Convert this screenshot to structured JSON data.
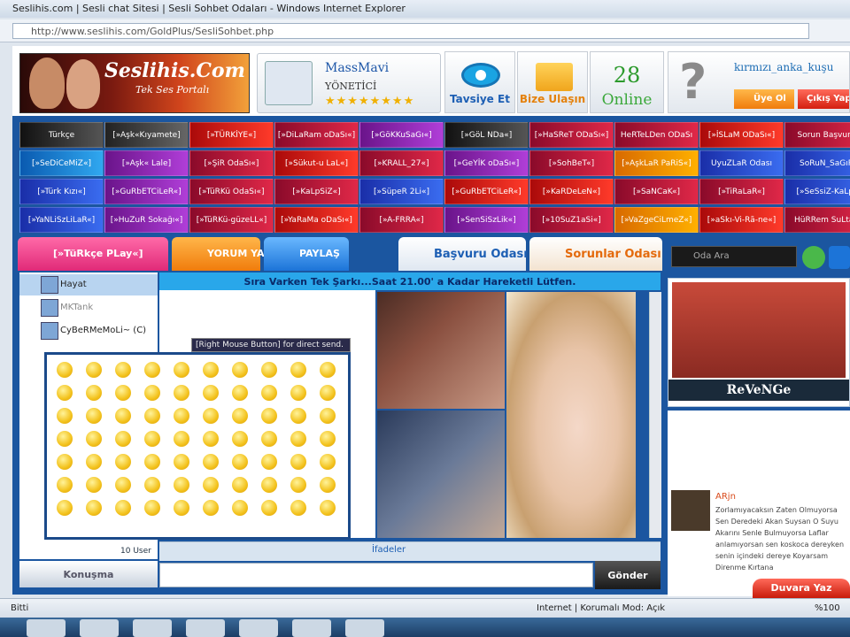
{
  "window": {
    "title": "Seslihis.com | Sesli chat Sitesi | Sesli Sohbet Odaları - Windows Internet Explorer",
    "url": "http://www.seslihis.com/GoldPlus/SesliSohbet.php"
  },
  "header": {
    "logo_text": "Seslihis.Com",
    "logo_sub": "Tek Ses Portalı",
    "admin_name": "MassMavi",
    "admin_role": "YÖNETİCİ",
    "admin_stars": "★★★★★★★★",
    "tavsiye": "Tavsiye Et",
    "bize": "Bize Ulaşın",
    "online_count": "28",
    "online_label": "Online",
    "username": "kırmızı_anka_kuşu",
    "uye_ol": "Üye Ol",
    "cikis": "Çıkış Yap"
  },
  "rooms": [
    {
      "label": "Türkçe",
      "c": "c0"
    },
    {
      "label": "[»Aşk«Kıyamete]",
      "c": "c6"
    },
    {
      "label": "[»TÜRKİYE«]",
      "c": "c7"
    },
    {
      "label": "[»DiLaRam oDaSı«]",
      "c": "c2"
    },
    {
      "label": "[»GöKKuSaGı«]",
      "c": "c3"
    },
    {
      "label": "[»GöL NDa«]",
      "c": "c0"
    },
    {
      "label": "[»HaSReT ODaSı«]",
      "c": "c2"
    },
    {
      "label": "HeRTeLDen ODaSı",
      "c": "c2"
    },
    {
      "label": "[»İSLaM ODaSı«]",
      "c": "c7"
    },
    {
      "label": "Sorun Başvuru",
      "c": "c2"
    },
    {
      "label": "[»SeDiCeMiZ«]",
      "c": "c4"
    },
    {
      "label": "[»Aşk« Lale]",
      "c": "c3"
    },
    {
      "label": "[»ŞiR OdaSı«]",
      "c": "c2"
    },
    {
      "label": "[»Sükut-u LaL«]",
      "c": "c7"
    },
    {
      "label": "[»KRALL_27«]",
      "c": "c2"
    },
    {
      "label": "[»GeYİK oDaSı«]",
      "c": "c3"
    },
    {
      "label": "[»SohBeT«]",
      "c": "c2"
    },
    {
      "label": "[»AşkLaR PaRiS«]",
      "c": "c5"
    },
    {
      "label": "UyuZLaR Odası",
      "c": "c1"
    },
    {
      "label": "SoRuN_SaGıR",
      "c": "c1"
    },
    {
      "label": "[»Türk Kızı«]",
      "c": "c1"
    },
    {
      "label": "[»GuRbETCiLeR«]",
      "c": "c3"
    },
    {
      "label": "[»TüRKü OdaSı«]",
      "c": "c2"
    },
    {
      "label": "[»KaLpSiZ«]",
      "c": "c2"
    },
    {
      "label": "[»SüpeR 2Li«]",
      "c": "c1"
    },
    {
      "label": "[»GuRbETCiLeR«]",
      "c": "c7"
    },
    {
      "label": "[»KaRDeLeN«]",
      "c": "c7"
    },
    {
      "label": "[»SaNCaK«]",
      "c": "c2"
    },
    {
      "label": "[»TiRaLaR«]",
      "c": "c2"
    },
    {
      "label": "[»SeSsiZ-KaLp]",
      "c": "c1"
    },
    {
      "label": "[»YaNLiSzLiLaR«]",
      "c": "c1"
    },
    {
      "label": "[»HuZuR Sokağı«]",
      "c": "c3"
    },
    {
      "label": "[»TüRKü-güzeLL«]",
      "c": "c2"
    },
    {
      "label": "[»YaRaMa oDaSı«]",
      "c": "c7"
    },
    {
      "label": "[»A-FRRA«]",
      "c": "c2"
    },
    {
      "label": "[»SenSiSzLik«]",
      "c": "c3"
    },
    {
      "label": "[»10SuZ1aSi«]",
      "c": "c2"
    },
    {
      "label": "[»VaZgeCiLmeZ«]",
      "c": "c5"
    },
    {
      "label": "[»aSkı-Vi-Rã-ne«]",
      "c": "c7"
    },
    {
      "label": "HüRRem SuLtan",
      "c": "c2"
    }
  ],
  "tabs": {
    "t1": "[»TüRkçe PLay«]",
    "t2": "YORUM YAP",
    "t3": "PAYLAŞ",
    "t4": "Başvuru Odası",
    "t5": "Sorunlar Odası"
  },
  "notice": "Sıra Varken Tek Şarkı...Saat 21.00' a Kadar Hareketli Lütfen.",
  "users": [
    "Hayat",
    "MKTank",
    "CyBeRMeMoLi~ (C)"
  ],
  "emotip": "[Right Mouse Button] for direct send.",
  "ifadeler": "İfadeler",
  "last": "10 User",
  "konusma": "Konuşma",
  "gonder": "Gönder",
  "search_placeholder": "Oda Ara",
  "featured_name": "ReVeNGe",
  "shout": {
    "name": "ARjn",
    "text": "Zorlamıyacaksın Zaten Olmuyorsa Sen Deredeki Akan Suysan O Suyu Akarını Senle Bulmuyorsa Laflar anlamıyorsan sen koskoca dereyken senin içindeki dereye Koyarsam Direnme Kırtana"
  },
  "duvara": "Duvara Yaz",
  "status": {
    "left": "Bitti",
    "center": "Internet | Korumalı Mod: Açık",
    "zoom": "%100"
  },
  "emoji_count": 70
}
